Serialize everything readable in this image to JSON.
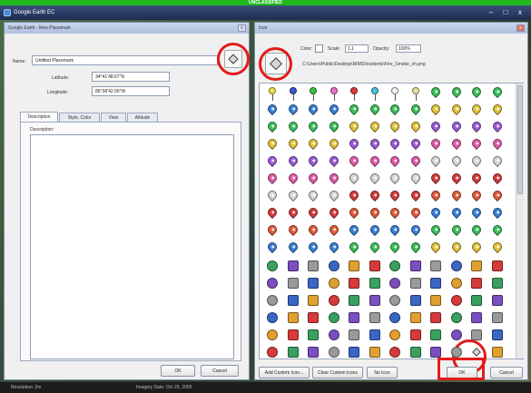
{
  "banner": "UNCLASSIFIED",
  "window": {
    "title": "Google Earth EC",
    "controls": {
      "minimize": "–",
      "maximize": "□",
      "close": "x"
    }
  },
  "placemark_dialog": {
    "title": "Google Earth - New Placemark",
    "close_glyph": "x",
    "name_label": "Name:",
    "name_value": "Untitled Placemark",
    "latitude_label": "Latitude:",
    "latitude_value": "34°41'48.67\"N",
    "longitude_label": "Longitude:",
    "longitude_value": "86°38'42.00\"W",
    "tabs": [
      "Description",
      "Style, Color",
      "View",
      "Altitude"
    ],
    "description_label": "Description:",
    "ok_label": "OK",
    "cancel_label": "Cancel"
  },
  "icon_dialog": {
    "title": "Icon",
    "close_glyph": "x",
    "color_label": "Color:",
    "scale_label": "Scale:",
    "scale_value": "1.1",
    "opacity_label": "Opacity:",
    "opacity_value": "100%",
    "path": "C:\\Users\\Public\\Desktop\\NIMS\\Incidents\\Fire_Smoke_ch.png",
    "add_custom_label": "Add Custom Icon...",
    "clear_custom_label": "Clear Custom Icons",
    "no_icon_label": "No Icon",
    "ok_label": "OK",
    "cancel_label": "Cancel",
    "pushpin_colors": [
      "#f2e44a",
      "#3b57c9",
      "#3cc246",
      "#ea73c9",
      "#dd3a3a",
      "#46c8e0",
      "#f4f4f4",
      "#e9e2a0"
    ],
    "pad_letters": [
      "A",
      "B",
      "C",
      "D",
      "E",
      "F",
      "G",
      "H",
      "I",
      "J",
      "K",
      "L",
      "M",
      "N",
      "O",
      "P",
      "Q",
      "R",
      "S",
      "T",
      "U",
      "V",
      "W",
      "X",
      "Y",
      "Z",
      "1",
      "2",
      "3",
      "4",
      "5",
      "6",
      "7",
      "8",
      "9",
      "10"
    ],
    "pad_colors": [
      "#e05a3a",
      "#3a7fd6",
      "#3bbf59",
      "#e0c23a",
      "#9b5bd6",
      "#e05aa8",
      "#d6d6d6",
      "#d63a3a"
    ],
    "symbol_colors": [
      "#9a9a9a",
      "#3a66c4",
      "#e0a030",
      "#d63a3a",
      "#3aa060",
      "#7a4fc0"
    ]
  },
  "statusbar": {
    "left": "Resolution: 2m",
    "right": "Imagery Date: Oct 29, 2006"
  }
}
